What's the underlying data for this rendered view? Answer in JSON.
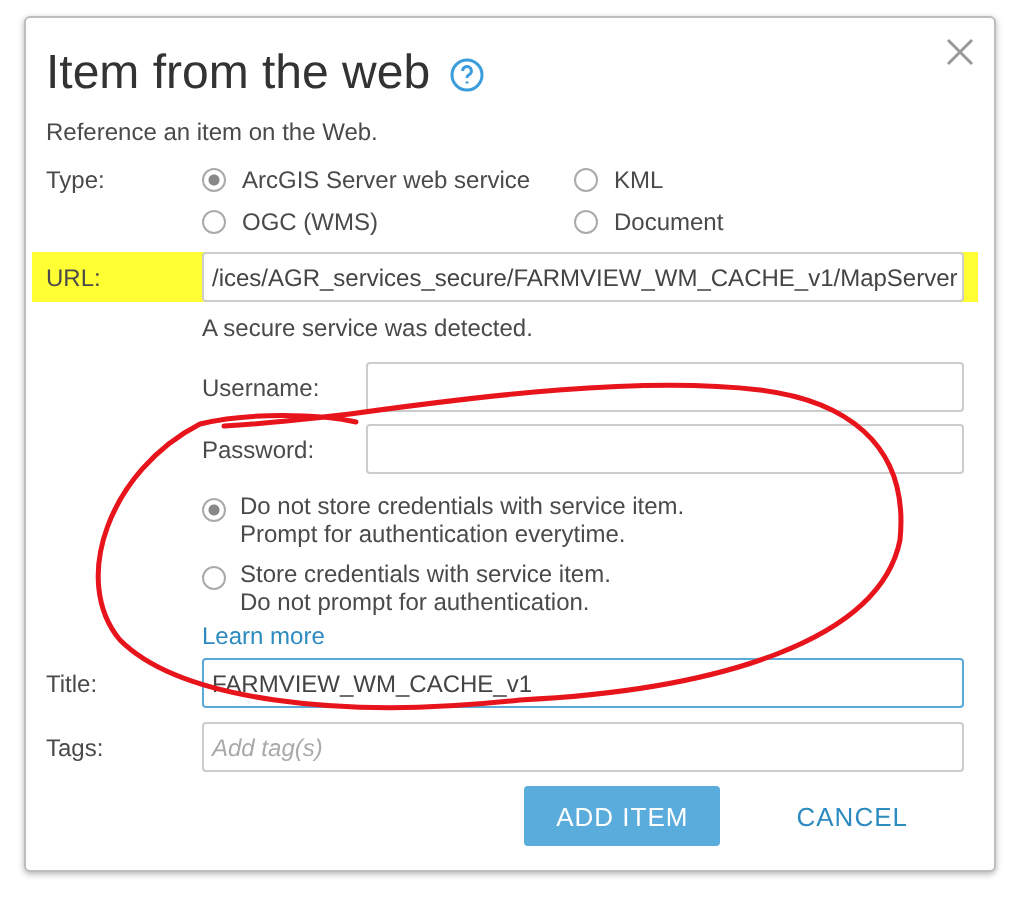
{
  "dialog": {
    "title": "Item from the web",
    "description": "Reference an item on the Web.",
    "type": {
      "label": "Type:",
      "options": [
        {
          "label": "ArcGIS Server web service",
          "selected": true
        },
        {
          "label": "KML",
          "selected": false
        },
        {
          "label": "OGC (WMS)",
          "selected": false
        },
        {
          "label": "Document",
          "selected": false
        }
      ]
    },
    "url": {
      "label": "URL:",
      "value": "/ices/AGR_services_secure/FARMVIEW_WM_CACHE_v1/MapServer",
      "highlighted": true
    },
    "secure_notice": "A secure service was detected.",
    "username": {
      "label": "Username:"
    },
    "password": {
      "label": "Password:"
    },
    "credentials": [
      {
        "line1": "Do not store credentials with service item.",
        "line2": "Prompt for authentication everytime.",
        "selected": true
      },
      {
        "line1": "Store credentials with service item.",
        "line2": "Do not prompt for authentication.",
        "selected": false
      }
    ],
    "learn_more": "Learn more",
    "title_field": {
      "label": "Title:",
      "value": "FARMVIEW_WM_CACHE_v1",
      "focused": true
    },
    "tags": {
      "label": "Tags:",
      "placeholder": "Add tag(s)"
    },
    "buttons": [
      {
        "label": "ADD ITEM",
        "kind": "primary"
      },
      {
        "label": "CANCEL",
        "kind": "link"
      }
    ]
  }
}
